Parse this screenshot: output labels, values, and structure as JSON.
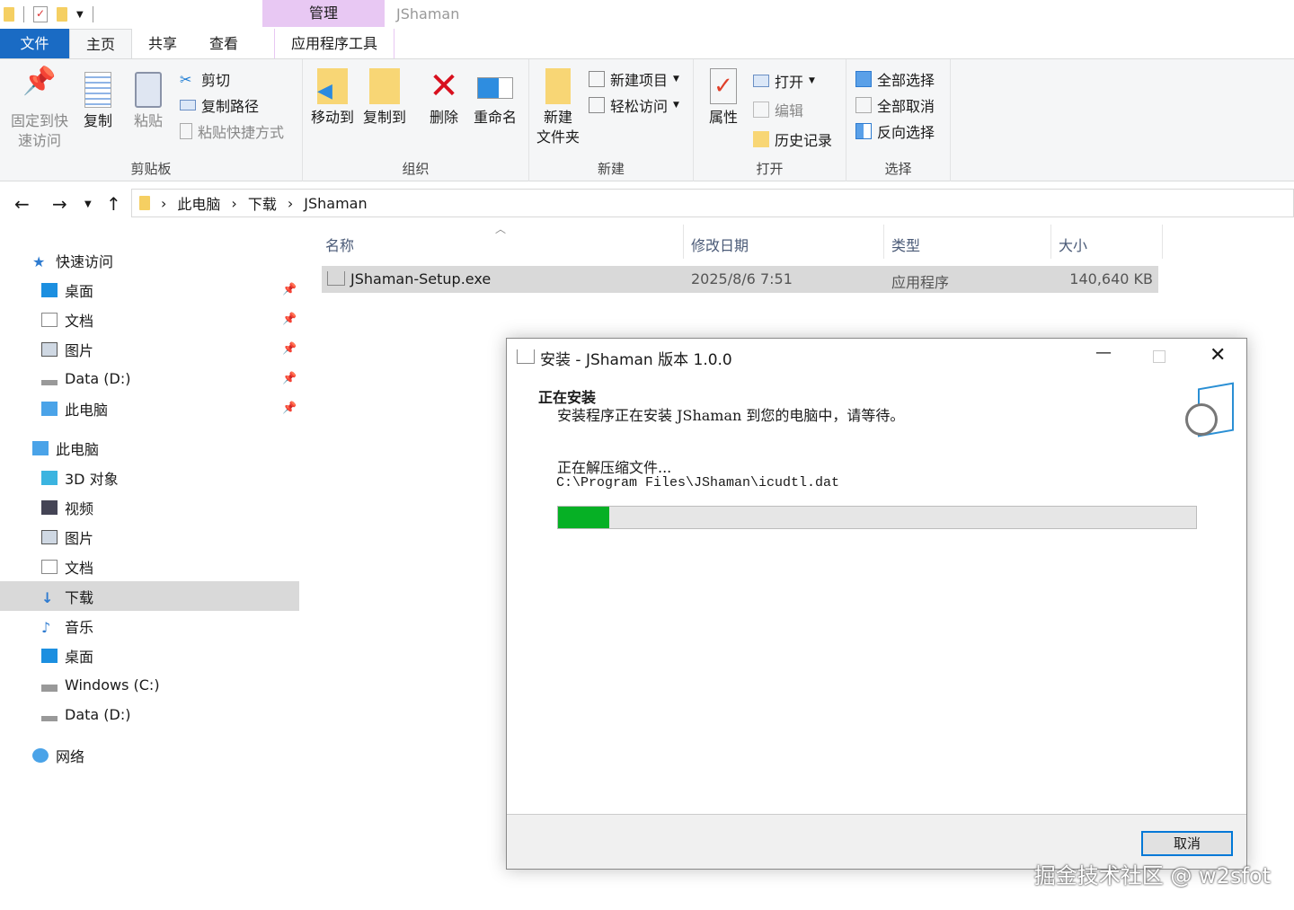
{
  "window": {
    "title": "JShaman",
    "context_tab": "管理"
  },
  "tabs": [
    "文件",
    "主页",
    "共享",
    "查看",
    "应用程序工具"
  ],
  "ribbon": {
    "clipboard": {
      "label": "剪贴板",
      "pin": "固定到快速访问",
      "pin1": "固定到快",
      "pin2": "速访问",
      "copy": "复制",
      "paste": "粘贴",
      "cut": "剪切",
      "copy_path": "复制路径",
      "paste_shortcut": "粘贴快捷方式"
    },
    "organize": {
      "label": "组织",
      "move_to": "移动到",
      "copy_to": "复制到",
      "delete": "删除",
      "rename": "重命名"
    },
    "new": {
      "label": "新建",
      "new_folder1": "新建",
      "new_folder2": "文件夹",
      "new_item": "新建项目",
      "easy_access": "轻松访问"
    },
    "open": {
      "label": "打开",
      "properties": "属性",
      "open": "打开",
      "edit": "编辑",
      "history": "历史记录"
    },
    "select": {
      "label": "选择",
      "select_all": "全部选择",
      "select_none": "全部取消",
      "invert": "反向选择"
    }
  },
  "address": {
    "crumbs": [
      "此电脑",
      "下载",
      "JShaman"
    ]
  },
  "nav": {
    "quick_access": "快速访问",
    "quick": [
      "桌面",
      "文档",
      "图片",
      "Data (D:)",
      "此电脑"
    ],
    "this_pc": "此电脑",
    "pc": [
      "3D 对象",
      "视频",
      "图片",
      "文档",
      "下载",
      "音乐",
      "桌面",
      "Windows (C:)",
      "Data (D:)"
    ],
    "network": "网络"
  },
  "columns": [
    "名称",
    "修改日期",
    "类型",
    "大小"
  ],
  "files": [
    {
      "name": "JShaman-Setup.exe",
      "modified": "2025/8/6 7:51",
      "type": "应用程序",
      "size": "140,640 KB"
    }
  ],
  "installer": {
    "title": "安装 - JShaman 版本 1.0.0",
    "heading": "正在安装",
    "subheading": "安装程序正在安装 JShaman 到您的电脑中，请等待。",
    "status": "正在解压缩文件...",
    "file": "C:\\Program Files\\JShaman\\icudtl.dat",
    "progress_percent": 8,
    "progress_color": "#06b025",
    "cancel": "取消"
  },
  "watermark": "掘金技术社区 @ w2sfot"
}
